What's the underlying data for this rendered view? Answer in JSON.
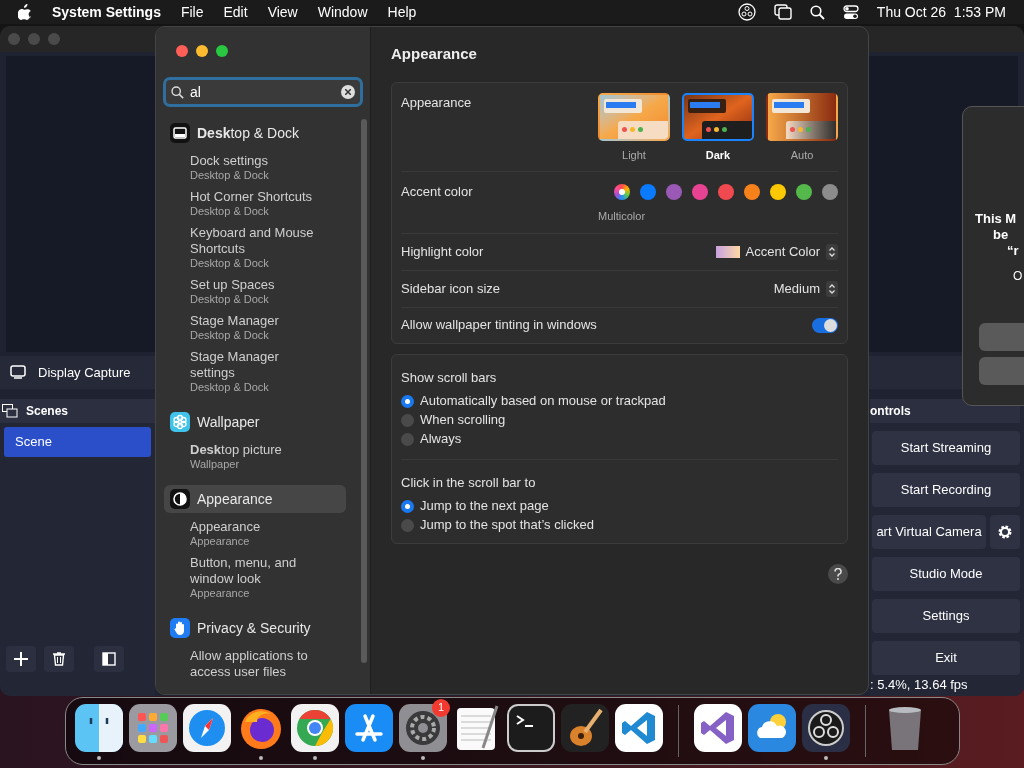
{
  "menubar": {
    "app": "System Settings",
    "menus": [
      "File",
      "Edit",
      "View",
      "Window",
      "Help"
    ],
    "clock": "Thu Oct 26  1:53 PM"
  },
  "obs": {
    "source": "Display Capture",
    "scenes_title": "Scenes",
    "scenes": [
      {
        "label": "Scene",
        "selected": true
      }
    ],
    "controls_title": "ontrols",
    "controls": [
      {
        "label": "Start Streaming",
        "kind": "wide"
      },
      {
        "label": "Start Recording",
        "kind": "wide"
      },
      {
        "label": "art Virtual Camera",
        "kind": "with-gear"
      },
      {
        "label": "Studio Mode",
        "kind": "wide"
      },
      {
        "label": "Settings",
        "kind": "wide"
      },
      {
        "label": "Exit",
        "kind": "wide"
      }
    ],
    "status": ": 5.4%, 13.64 fps"
  },
  "dialog": {
    "lines": [
      "This M",
      "be",
      "“r"
    ],
    "note": "O"
  },
  "settings": {
    "search": {
      "value": "al"
    },
    "sidebar": [
      {
        "kind": "dock",
        "label": "**Desk**top & Dock",
        "selected": false,
        "results": [
          {
            "title": "Dock settings",
            "subtitle": "Desktop & Dock"
          },
          {
            "title": "Hot Corner Shortcuts",
            "subtitle": "Desktop & Dock"
          },
          {
            "title": "Keyboard and Mouse Shortcuts",
            "subtitle": "Desktop & Dock"
          },
          {
            "title": "Set up Spaces",
            "subtitle": "Desktop & Dock"
          },
          {
            "title": "Stage Manager",
            "subtitle": "Desktop & Dock"
          },
          {
            "title": "Stage Manager settings",
            "subtitle": "Desktop & Dock"
          }
        ]
      },
      {
        "kind": "wallpaper",
        "label": "Wallpaper",
        "selected": false,
        "results": [
          {
            "title": "**Desk**top picture",
            "subtitle": "Wallpaper"
          }
        ]
      },
      {
        "kind": "appearance",
        "label": "Appearance",
        "selected": true,
        "results": [
          {
            "title": "Appearance",
            "subtitle": "Appearance"
          },
          {
            "title": "Button, menu, and window look",
            "subtitle": "Appearance"
          }
        ]
      },
      {
        "kind": "privacy",
        "label": "Privacy & Security",
        "selected": false,
        "results": [
          {
            "title": "Allow applications to access user files"
          }
        ]
      }
    ],
    "title": "Appearance",
    "appearance": {
      "label": "Appearance",
      "options": [
        {
          "label": "Light",
          "kind": "light",
          "selected": false
        },
        {
          "label": "Dark",
          "kind": "dark",
          "selected": true
        },
        {
          "label": "Auto",
          "kind": "auto",
          "selected": false
        }
      ]
    },
    "accent": {
      "label": "Accent color",
      "caption": "Multicolor",
      "colors": [
        {
          "kind": "multicolor",
          "selected": true
        },
        {
          "kind": "solid",
          "color": "#0a7aff",
          "selected": false
        },
        {
          "kind": "solid",
          "color": "#9b59b6",
          "selected": false
        },
        {
          "kind": "solid",
          "color": "#e84393",
          "selected": false
        },
        {
          "kind": "solid",
          "color": "#f0494f",
          "selected": false
        },
        {
          "kind": "solid",
          "color": "#f7821b",
          "selected": false
        },
        {
          "kind": "solid",
          "color": "#fcc900",
          "selected": false
        },
        {
          "kind": "solid",
          "color": "#55b84a",
          "selected": false
        },
        {
          "kind": "solid",
          "color": "#8c8c8c",
          "selected": false
        }
      ]
    },
    "highlight": {
      "label": "Highlight color",
      "value": "Accent Color"
    },
    "icon_size": {
      "label": "Sidebar icon size",
      "value": "Medium"
    },
    "tinting": {
      "label": "Allow wallpaper tinting in windows",
      "on": true
    },
    "scroll_bars": {
      "label": "Show scroll bars",
      "options": [
        {
          "label": "Automatically based on mouse or trackpad",
          "selected": true
        },
        {
          "label": "When scrolling",
          "selected": false
        },
        {
          "label": "Always",
          "selected": false
        }
      ]
    },
    "click": {
      "label": "Click in the scroll bar to",
      "options": [
        {
          "label": "Jump to the next page",
          "selected": true
        },
        {
          "label": "Jump to the spot that’s clicked",
          "selected": false
        }
      ]
    }
  },
  "dock": {
    "sections": [
      [
        {
          "kind": "finder",
          "running": true
        },
        {
          "kind": "launchpad",
          "running": false
        },
        {
          "kind": "safari",
          "running": false
        },
        {
          "kind": "firefox",
          "running": true
        },
        {
          "kind": "chrome",
          "running": true
        },
        {
          "kind": "appstore",
          "running": false
        },
        {
          "kind": "settings",
          "running": true,
          "badge": "1"
        },
        {
          "kind": "textedit",
          "running": false
        },
        {
          "kind": "terminal",
          "running": false
        },
        {
          "kind": "garageband",
          "running": false
        },
        {
          "kind": "vscode",
          "running": false
        }
      ],
      [
        {
          "kind": "visualstudio",
          "running": false
        },
        {
          "kind": "weather",
          "running": false
        },
        {
          "kind": "obs",
          "running": true
        }
      ],
      [
        {
          "kind": "trash",
          "running": false
        }
      ]
    ]
  }
}
